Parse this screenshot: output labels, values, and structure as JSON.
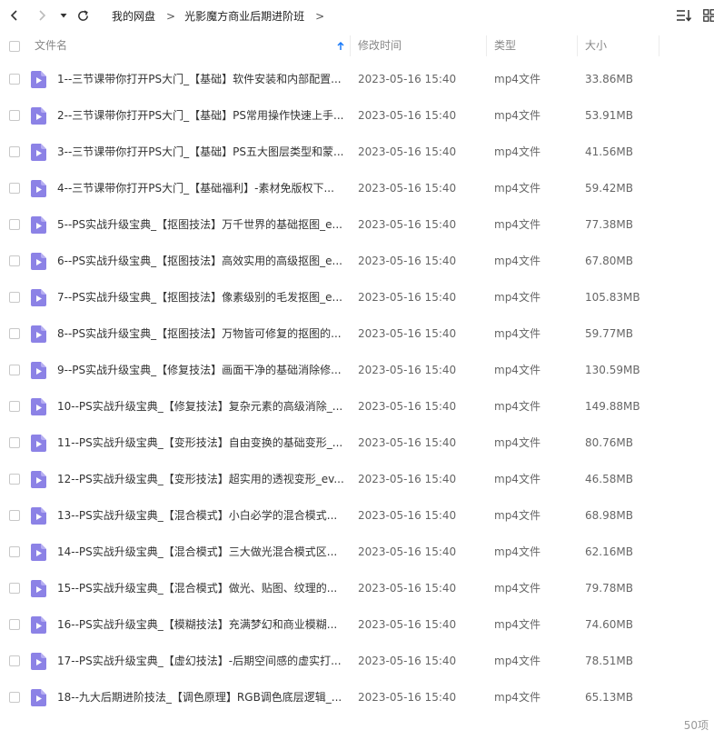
{
  "breadcrumb": [
    "我的网盘",
    "光影魔方商业后期进阶班"
  ],
  "breadcrumb_separator": ">",
  "columns": {
    "name": "文件名",
    "modified": "修改时间",
    "type": "类型",
    "size": "大小"
  },
  "colors": {
    "accent": "#1a7af8",
    "video_icon": "#8c82e6"
  },
  "icons": {
    "back": "chevron-left-icon",
    "forward": "chevron-right-icon",
    "dropdown": "caret-down-icon",
    "refresh": "refresh-icon",
    "sort": "sort-list-icon",
    "grid": "grid-view-icon",
    "sort_arrow": "sort-up-arrow-icon",
    "file": "video-file-icon"
  },
  "files": [
    {
      "name": "1--三节课带你打开PS大门_【基础】软件安装和内部配置...",
      "modified": "2023-05-16 15:40",
      "type": "mp4文件",
      "size": "33.86MB"
    },
    {
      "name": "2--三节课带你打开PS大门_【基础】PS常用操作快速上手...",
      "modified": "2023-05-16 15:40",
      "type": "mp4文件",
      "size": "53.91MB"
    },
    {
      "name": "3--三节课带你打开PS大门_【基础】PS五大图层类型和蒙...",
      "modified": "2023-05-16 15:40",
      "type": "mp4文件",
      "size": "41.56MB"
    },
    {
      "name": "4--三节课带你打开PS大门_【基础福利】-素材免版权下...",
      "modified": "2023-05-16 15:40",
      "type": "mp4文件",
      "size": "59.42MB"
    },
    {
      "name": "5--PS实战升级宝典_【抠图技法】万千世界的基础抠图_e...",
      "modified": "2023-05-16 15:40",
      "type": "mp4文件",
      "size": "77.38MB"
    },
    {
      "name": "6--PS实战升级宝典_【抠图技法】高效实用的高级抠图_e...",
      "modified": "2023-05-16 15:40",
      "type": "mp4文件",
      "size": "67.80MB"
    },
    {
      "name": "7--PS实战升级宝典_【抠图技法】像素级别的毛发抠图_e...",
      "modified": "2023-05-16 15:40",
      "type": "mp4文件",
      "size": "105.83MB"
    },
    {
      "name": "8--PS实战升级宝典_【抠图技法】万物皆可修复的抠图的...",
      "modified": "2023-05-16 15:40",
      "type": "mp4文件",
      "size": "59.77MB"
    },
    {
      "name": "9--PS实战升级宝典_【修复技法】画面干净的基础消除修...",
      "modified": "2023-05-16 15:40",
      "type": "mp4文件",
      "size": "130.59MB"
    },
    {
      "name": "10--PS实战升级宝典_【修复技法】复杂元素的高级消除_...",
      "modified": "2023-05-16 15:40",
      "type": "mp4文件",
      "size": "149.88MB"
    },
    {
      "name": "11--PS实战升级宝典_【变形技法】自由变换的基础变形_...",
      "modified": "2023-05-16 15:40",
      "type": "mp4文件",
      "size": "80.76MB"
    },
    {
      "name": "12--PS实战升级宝典_【变形技法】超实用的透视变形_ev...",
      "modified": "2023-05-16 15:40",
      "type": "mp4文件",
      "size": "46.58MB"
    },
    {
      "name": "13--PS实战升级宝典_【混合模式】小白必学的混合模式...",
      "modified": "2023-05-16 15:40",
      "type": "mp4文件",
      "size": "68.98MB"
    },
    {
      "name": "14--PS实战升级宝典_【混合模式】三大做光混合模式区...",
      "modified": "2023-05-16 15:40",
      "type": "mp4文件",
      "size": "62.16MB"
    },
    {
      "name": "15--PS实战升级宝典_【混合模式】做光、贴图、纹理的...",
      "modified": "2023-05-16 15:40",
      "type": "mp4文件",
      "size": "79.78MB"
    },
    {
      "name": "16--PS实战升级宝典_【模糊技法】充满梦幻和商业模糊...",
      "modified": "2023-05-16 15:40",
      "type": "mp4文件",
      "size": "74.60MB"
    },
    {
      "name": "17--PS实战升级宝典_【虚幻技法】-后期空间感的虚实打...",
      "modified": "2023-05-16 15:40",
      "type": "mp4文件",
      "size": "78.51MB"
    },
    {
      "name": "18--九大后期进阶技法_【调色原理】RGB调色底层逻辑_...",
      "modified": "2023-05-16 15:40",
      "type": "mp4文件",
      "size": "65.13MB"
    }
  ],
  "footer": {
    "count": "50项"
  }
}
